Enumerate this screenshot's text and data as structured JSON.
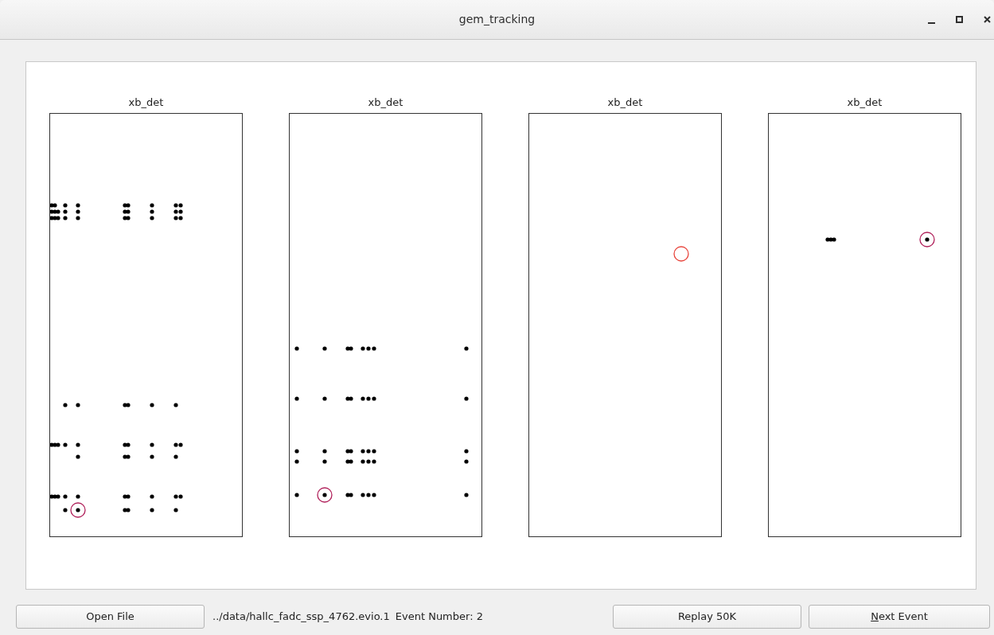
{
  "window": {
    "title": "gem_tracking"
  },
  "plots": [
    {
      "title": "xb_det"
    },
    {
      "title": "xb_det"
    },
    {
      "title": "xb_det"
    },
    {
      "title": "xb_det"
    }
  ],
  "footer": {
    "open_button": {
      "label": "Open File",
      "mnemonic": false
    },
    "file_path": "../data/hallc_fadc_ssp_4762.evio.1",
    "event_number": "Event Number: 2",
    "buttons": [
      {
        "label": "Replay 50K",
        "mnemonic": false
      },
      {
        "label": "Next Event",
        "mnemonic": true
      }
    ]
  }
}
